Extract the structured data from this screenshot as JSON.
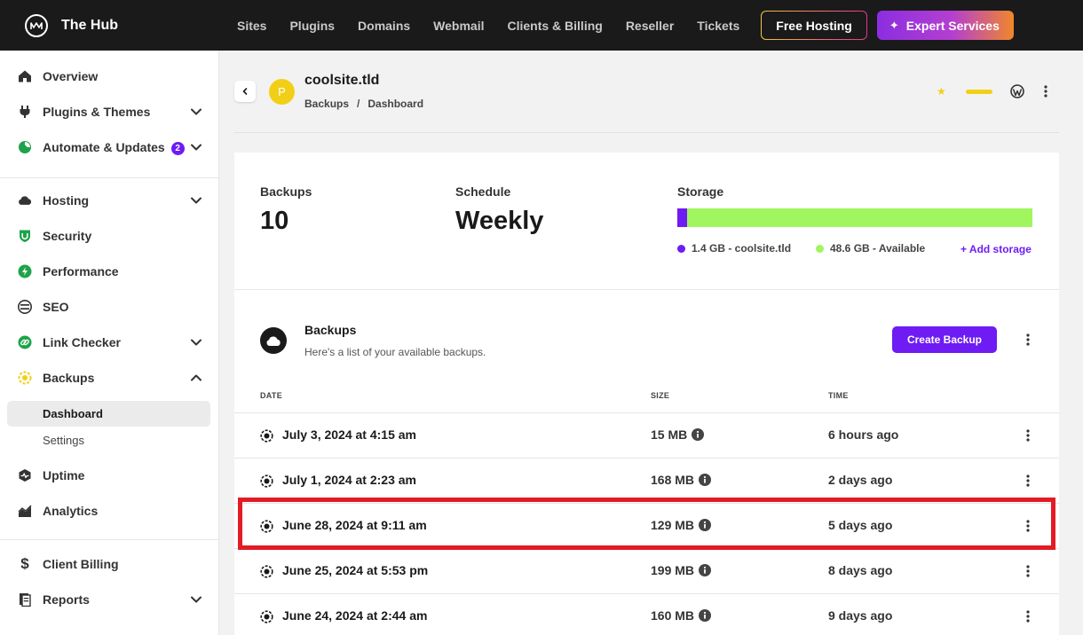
{
  "app": {
    "brand": "The Hub"
  },
  "topnav": {
    "items": [
      "Sites",
      "Plugins",
      "Domains",
      "Webmail",
      "Clients & Billing",
      "Reseller",
      "Tickets"
    ],
    "free_hosting": "Free Hosting",
    "expert_services": "Expert Services"
  },
  "sidebar": {
    "items": [
      {
        "label": "Overview",
        "icon": "home-icon"
      },
      {
        "label": "Plugins & Themes",
        "icon": "plug-icon"
      },
      {
        "label": "Automate & Updates",
        "icon": "automate-icon",
        "badge": "2"
      },
      {
        "label": "Hosting",
        "icon": "cloud-icon"
      },
      {
        "label": "Security",
        "icon": "shield-icon"
      },
      {
        "label": "Performance",
        "icon": "bolt-icon"
      },
      {
        "label": "SEO",
        "icon": "seo-icon"
      },
      {
        "label": "Link Checker",
        "icon": "link-icon"
      },
      {
        "label": "Backups",
        "icon": "backups-icon"
      },
      {
        "label": "Uptime",
        "icon": "uptime-icon"
      },
      {
        "label": "Analytics",
        "icon": "analytics-icon"
      },
      {
        "label": "Client Billing",
        "icon": "dollar-icon"
      },
      {
        "label": "Reports",
        "icon": "reports-icon"
      }
    ],
    "backups_sub": [
      "Dashboard",
      "Settings"
    ]
  },
  "site": {
    "avatar_letter": "P",
    "title": "coolsite.tld",
    "breadcrumb": [
      "Backups",
      "Dashboard"
    ]
  },
  "stats": {
    "backups_label": "Backups",
    "backups_value": "10",
    "schedule_label": "Schedule",
    "schedule_value": "Weekly",
    "storage_label": "Storage",
    "used_fraction": 0.028,
    "used_legend": "1.4 GB - coolsite.tld",
    "available_legend": "48.6 GB - Available",
    "add_storage": "+ Add storage",
    "used_color": "#6e1bf4",
    "available_color": "#a1f55e"
  },
  "backups_section": {
    "title": "Backups",
    "subtitle": "Here's a list of your available backups.",
    "create_button": "Create Backup",
    "columns": {
      "date": "DATE",
      "size": "SIZE",
      "time": "TIME"
    },
    "rows": [
      {
        "date": "July 3, 2024 at 4:15 am",
        "size": "15 MB",
        "time": "6 hours ago"
      },
      {
        "date": "July 1, 2024 at 2:23 am",
        "size": "168 MB",
        "time": "2 days ago"
      },
      {
        "date": "June 28, 2024 at 9:11 am",
        "size": "129 MB",
        "time": "5 days ago",
        "highlighted": true
      },
      {
        "date": "June 25, 2024 at 5:53 pm",
        "size": "199 MB",
        "time": "8 days ago"
      },
      {
        "date": "June 24, 2024 at 2:44 am",
        "size": "160 MB",
        "time": "9 days ago"
      }
    ]
  },
  "colors": {
    "accent": "#6e1bf4",
    "highlight": "#e21b25",
    "site_avatar": "#f2cf17"
  }
}
